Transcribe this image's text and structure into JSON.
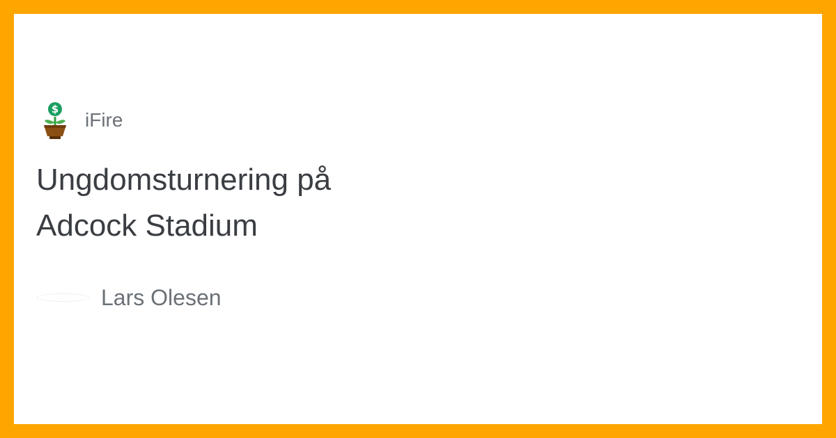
{
  "brand": {
    "name": "iFire",
    "icon": "money-plant-icon"
  },
  "article": {
    "title": "Ungdomsturnering på Adcock Stadium"
  },
  "author": {
    "name": "Lars Olesen",
    "avatar": "avatar"
  },
  "colors": {
    "frame": "#ffa500",
    "card": "#ffffff",
    "title": "#3a3d42",
    "muted": "#6b7177"
  }
}
